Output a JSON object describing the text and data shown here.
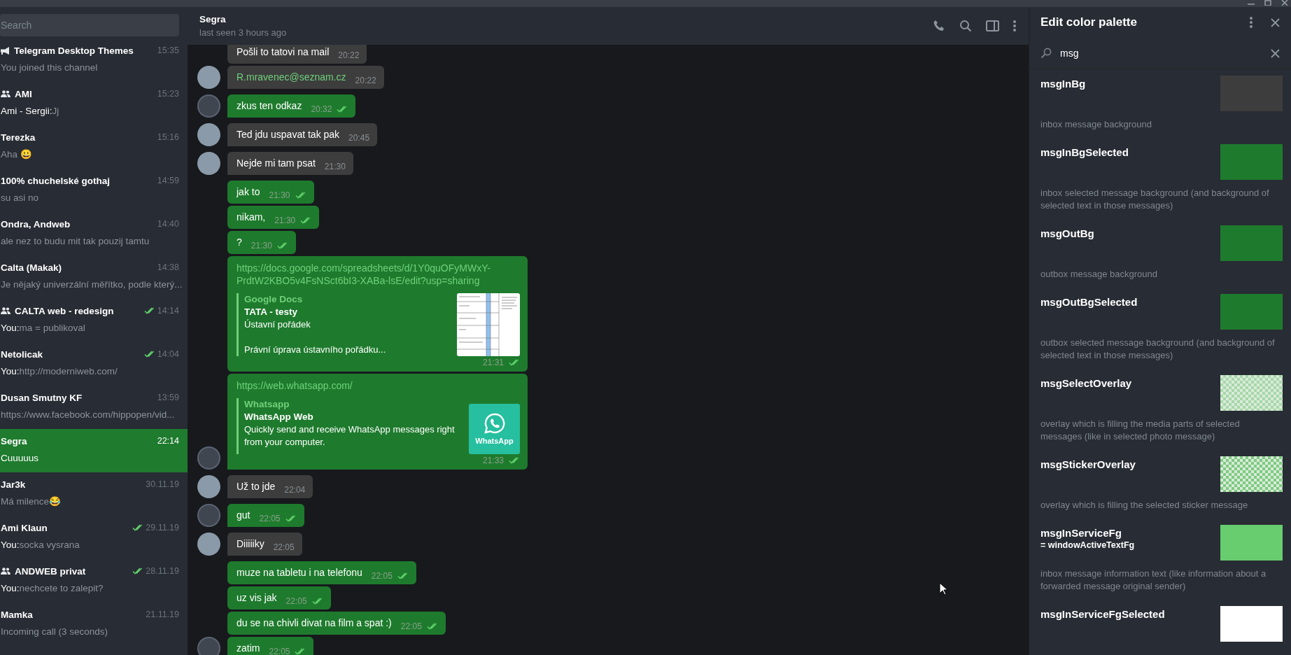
{
  "sidebar": {
    "search": {
      "placeholder": "Search"
    },
    "chats": [
      {
        "kind": "channel",
        "name": "Telegram Desktop Themes",
        "time": "15:35",
        "preview": "You joined this channel",
        "read": false,
        "selected": false
      },
      {
        "kind": "group",
        "name": "AMI",
        "time": "15:23",
        "sender": "Ami - Sergii:",
        "preview": "Jj",
        "read": false,
        "selected": false
      },
      {
        "kind": "person",
        "name": "Terezka",
        "time": "15:16",
        "preview": "Aha 😀",
        "read": false,
        "selected": false
      },
      {
        "kind": "person",
        "name": "100% chuchelské gothaj",
        "time": "14:59",
        "preview": "su asi no",
        "read": false,
        "selected": false
      },
      {
        "kind": "person",
        "name": "Ondra, Andweb",
        "time": "14:40",
        "preview": "ale nez to budu mit tak pouzij tamtu",
        "read": false,
        "selected": false
      },
      {
        "kind": "person",
        "name": "Calta (Makak)",
        "time": "14:38",
        "preview": "Je nějaký univerzální měřítko, podle který...",
        "read": false,
        "selected": false
      },
      {
        "kind": "group",
        "name": "CALTA web - redesign",
        "time": "14:14",
        "sender": "You:",
        "preview": "ma = publikoval",
        "read": true,
        "selected": false
      },
      {
        "kind": "person",
        "name": "Netolicak",
        "time": "14:04",
        "sender": "You:",
        "preview": "http://moderniweb.com/",
        "read": true,
        "selected": false
      },
      {
        "kind": "person",
        "name": "Dusan Smutny KF",
        "time": "13:59",
        "preview": "https://www.facebook.com/hippopen/vid...",
        "read": false,
        "selected": false
      },
      {
        "kind": "person",
        "name": "Segra",
        "time": "22:14",
        "preview": "Cuuuuus",
        "read": false,
        "selected": true
      },
      {
        "kind": "person",
        "name": "Jar3k",
        "time": "30.11.19",
        "preview": "Má milence😂",
        "read": false,
        "selected": false
      },
      {
        "kind": "person",
        "name": "Ami Klaun",
        "time": "29.11.19",
        "sender": "You:",
        "preview": "socka vysrana",
        "read": true,
        "selected": false
      },
      {
        "kind": "group",
        "name": "ANDWEB privat",
        "time": "28.11.19",
        "sender": "You:",
        "preview": "nechcete to zalepit?",
        "read": true,
        "selected": false
      },
      {
        "kind": "person",
        "name": "Mamka",
        "time": "21.11.19",
        "preview": "Incoming call (3 seconds)",
        "read": false,
        "selected": false
      }
    ]
  },
  "chat": {
    "header": {
      "name": "Segra",
      "status": "last seen 3 hours ago"
    },
    "messages": [
      {
        "kind": "text",
        "out": false,
        "avatar": false,
        "text": "Pošli to tatovi na mail",
        "time": "20:22"
      },
      {
        "kind": "link",
        "out": false,
        "avatar": true,
        "text": "R.mravenec@seznam.cz",
        "time": "20:22"
      },
      {
        "kind": "text",
        "out": true,
        "avatar": true,
        "text": "zkus ten odkaz",
        "time": "20:32"
      },
      {
        "kind": "text",
        "out": false,
        "avatar": true,
        "text": "Ted jdu uspavat tak pak",
        "time": "20:45"
      },
      {
        "kind": "text",
        "out": false,
        "avatar": true,
        "text": "Nejde mi tam psat",
        "time": "21:30"
      },
      {
        "kind": "text",
        "out": true,
        "avatar": false,
        "text": "jak to",
        "time": "21:30"
      },
      {
        "kind": "text",
        "out": true,
        "avatar": false,
        "text": "nikam,",
        "time": "21:30"
      },
      {
        "kind": "text",
        "out": true,
        "avatar": false,
        "text": "?",
        "time": "21:30"
      },
      {
        "kind": "preview",
        "out": true,
        "avatar": false,
        "url": "https://docs.google.com/spreadsheets/d/1Y0quOFyMWxY-PrdtW2KBO5v4FsNSct6bI3-XABa-lsE/edit?usp=sharing",
        "site": "Google Docs",
        "title": "TATA  - testy",
        "description": "Ústavní pořádek\n\nPrávní úprava ústavního pořádku...",
        "thumbnail": {
          "kind": "spreadsheet"
        },
        "time": "21:31"
      },
      {
        "kind": "preview",
        "out": true,
        "avatar": true,
        "url": "https://web.whatsapp.com/",
        "site": "Whatsapp",
        "title": "WhatsApp Web",
        "description": "Quickly send and receive WhatsApp messages right from your computer.",
        "thumbnail": {
          "kind": "logo",
          "label": "WhatsApp"
        },
        "time": "21:33"
      },
      {
        "kind": "text",
        "out": false,
        "avatar": true,
        "text": "Už to jde",
        "time": "22:04"
      },
      {
        "kind": "text",
        "out": true,
        "avatar": true,
        "text": "gut",
        "time": "22:05"
      },
      {
        "kind": "text",
        "out": false,
        "avatar": true,
        "text": "Diiiiiky",
        "time": "22:05"
      },
      {
        "kind": "text",
        "out": true,
        "avatar": false,
        "text": "muze na tabletu i na telefonu",
        "time": "22:05"
      },
      {
        "kind": "text",
        "out": true,
        "avatar": false,
        "text": "uz vis jak",
        "time": "22:05"
      },
      {
        "kind": "text",
        "out": true,
        "avatar": false,
        "text": "du se na chivli divat na film a spat :)",
        "time": "22:05"
      },
      {
        "kind": "text",
        "out": true,
        "avatar": true,
        "text": "zatim",
        "time": "22:05"
      }
    ]
  },
  "palette": {
    "title": "Edit color palette",
    "search": {
      "value": "msg"
    },
    "entries": [
      {
        "name": "msgInBg",
        "color": "#3d3d3d",
        "checkered": false,
        "description": "inbox message background"
      },
      {
        "name": "msgInBgSelected",
        "color": "#1e7b2d",
        "checkered": false,
        "description": "inbox selected message background (and background of selected text in those messages)"
      },
      {
        "name": "msgOutBg",
        "color": "#1e7b2d",
        "checkered": false,
        "description": "outbox message background"
      },
      {
        "name": "msgOutBgSelected",
        "color": "#1e7b2d",
        "checkered": false,
        "description": "outbox selected message background (and background of selected text in those messages)"
      },
      {
        "name": "msgSelectOverlay",
        "color": "#a6d8a8",
        "checkered": true,
        "description": "overlay which is filling the media parts of selected messages (like in selected photo message)"
      },
      {
        "name": "msgStickerOverlay",
        "color": "#7ccb80",
        "checkered": true,
        "description": "overlay which is filling the selected sticker message"
      },
      {
        "name": "msgInServiceFg",
        "alias": "= windowActiveTextFg",
        "color": "#68cd6e",
        "checkered": false,
        "description": "inbox message information text (like information about a forwarded message original sender)"
      },
      {
        "name": "msgInServiceFgSelected",
        "color": "#ffffff",
        "checkered": false
      }
    ]
  }
}
